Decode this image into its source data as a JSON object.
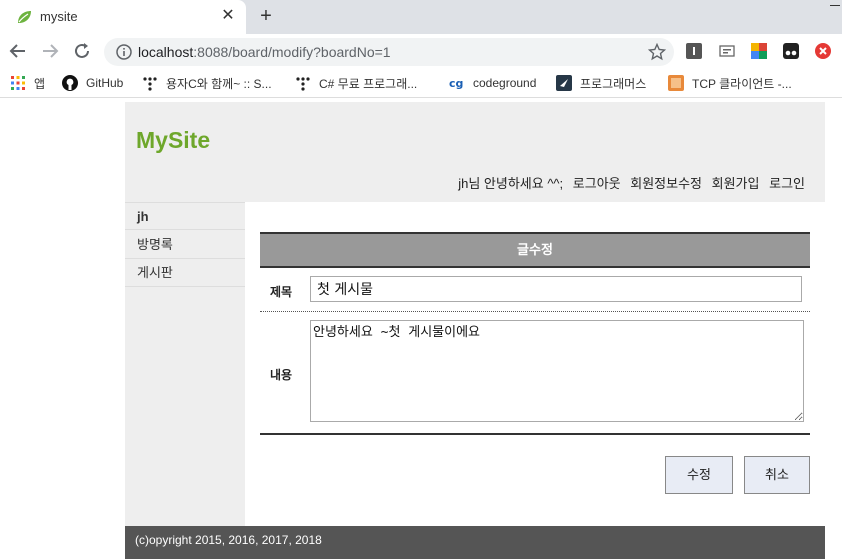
{
  "browser": {
    "tab": {
      "title": "mysite",
      "close": "✕"
    },
    "new_tab": "+",
    "url": {
      "host": "localhost",
      "rest": ":8088/board/modify?boardNo=1"
    },
    "bookmarks": [
      {
        "label": "앱",
        "icon": "apps-grid-icon"
      },
      {
        "label": "GitHub",
        "icon": "github-icon"
      },
      {
        "label": "용자C와 함께~ :: S...",
        "icon": "dots-icon"
      },
      {
        "label": "C# 무료 프로그래...",
        "icon": "dots-icon"
      },
      {
        "label": "codeground",
        "icon": "codeground-icon"
      },
      {
        "label": "프로그래머스",
        "icon": "programmers-icon"
      },
      {
        "label": "TCP 클라이언트 -...",
        "icon": "tcp-icon"
      }
    ]
  },
  "site": {
    "logo": "MySite",
    "user_links": {
      "greeting": "jh님 안녕하세요 ^^;",
      "logout": "로그아웃",
      "modify_info": "회원정보수정",
      "join": "회원가입",
      "login": "로그인"
    },
    "sidebar": [
      {
        "label": "jh"
      },
      {
        "label": "방명록"
      },
      {
        "label": "게시판"
      }
    ],
    "board": {
      "heading": "글수정",
      "title_label": "제목",
      "title_value": "첫 게시물",
      "content_label": "내용",
      "content_value": "안녕하세요 ~첫 게시물이에요",
      "submit": "수정",
      "cancel": "취소"
    },
    "footer": "(c)opyright 2015, 2016, 2017, 2018"
  },
  "colors": {
    "logo": "#6ea72b",
    "header_bg": "#eeeeee",
    "board_head": "#999999",
    "footer_bg": "#555555"
  }
}
